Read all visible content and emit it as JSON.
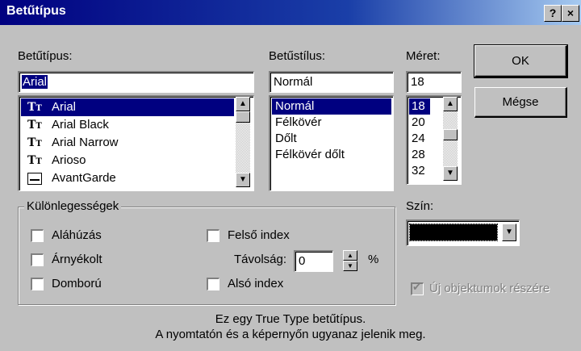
{
  "dialog": {
    "title": "Betűtípus",
    "help_label": "?",
    "close_label": "×"
  },
  "font": {
    "label": "Betűtípus:",
    "value": "Arial",
    "items": [
      "Arial",
      "Arial Black",
      "Arial Narrow",
      "Arioso",
      "AvantGarde"
    ],
    "selected_index": 0
  },
  "style": {
    "label": "Betűstílus:",
    "value": "Normál",
    "items": [
      "Normál",
      "Félkövér",
      "Dőlt",
      "Félkövér dőlt"
    ],
    "selected_index": 0
  },
  "size": {
    "label": "Méret:",
    "value": "18",
    "items": [
      "18",
      "20",
      "24",
      "28",
      "32"
    ],
    "selected_index": 0
  },
  "buttons": {
    "ok": "OK",
    "cancel": "Mégse"
  },
  "effects": {
    "title": "Különlegességek",
    "underline": "Aláhúzás",
    "shadow": "Árnyékolt",
    "emboss": "Domború",
    "superscript": "Felső index",
    "subscript": "Alsó index",
    "offset_label": "Távolság:",
    "offset_value": "0",
    "percent": "%"
  },
  "color": {
    "label": "Szín:",
    "value_hex": "#000000"
  },
  "new_objects": {
    "label": "Új objektumok részére",
    "checked": true,
    "disabled": true
  },
  "info": {
    "line1": "Ez egy True Type betűtípus.",
    "line2": "A nyomtatón és a képernyőn ugyanaz jelenik meg."
  },
  "icons": {
    "truetype": "truetype-font-icon",
    "printer": "printer-font-icon"
  }
}
